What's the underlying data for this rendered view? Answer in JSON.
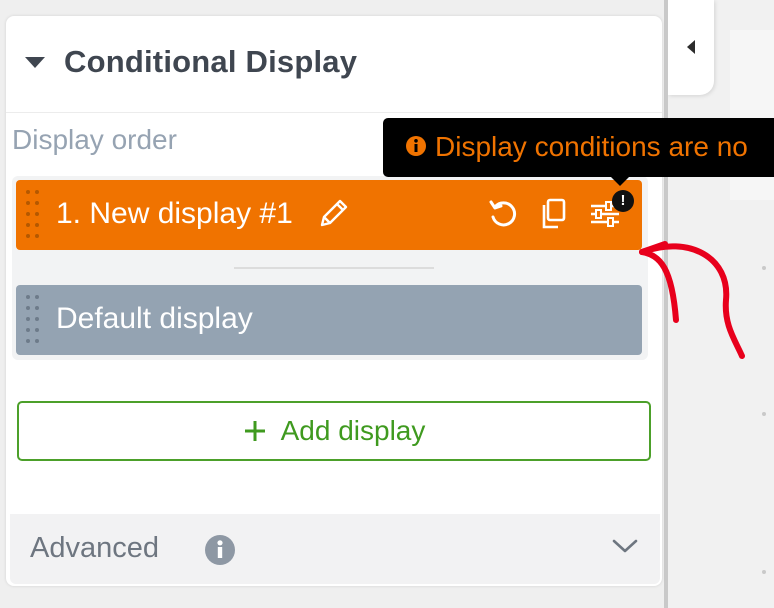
{
  "section": {
    "title": "Conditional Display",
    "display_order_label": "Display order"
  },
  "displays": [
    {
      "label": "1.  New display #1"
    },
    {
      "label": "Default display"
    }
  ],
  "tooltip": {
    "text": "Display conditions are no"
  },
  "add_display": {
    "label": "Add display"
  },
  "advanced": {
    "label": "Advanced"
  },
  "colors": {
    "accent_orange": "#f07300",
    "default_gray": "#94a3b2",
    "add_green": "#4ca02a",
    "annotation_red": "#e8001c"
  },
  "icons": {
    "caret": "caret-down-icon",
    "pencil": "pencil-icon",
    "reset": "reset-icon",
    "copy": "copy-icon",
    "sliders": "sliders-icon",
    "warning": "exclamation-badge-icon",
    "info": "info-icon",
    "plus": "plus-icon",
    "chevron": "chevron-down-icon",
    "collapse": "triangle-left-icon"
  }
}
